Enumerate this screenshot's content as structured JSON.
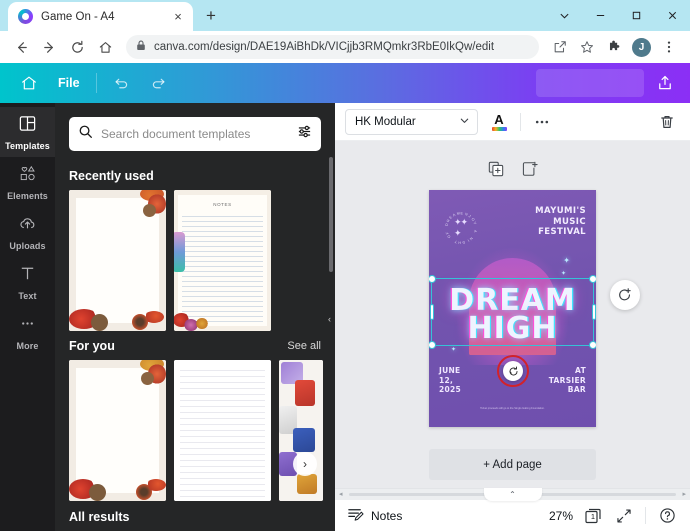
{
  "browser": {
    "tab": {
      "title": "Game On - A4",
      "favicon": "canva-favicon",
      "close": "×"
    },
    "new_tab_label": "+",
    "window_controls": {
      "minimize_chevron": "⌄",
      "minimize": "–",
      "maximize": "□",
      "close": "✕"
    },
    "nav": {
      "back": "←",
      "forward": "→",
      "reload": "⟳",
      "home": "⌂"
    },
    "omnibox": {
      "url": "canva.com/design/DAE19AiBhDk/VICjjb3RMQmkr3RbE0IkQw/edit",
      "lock_icon": "site-lock-icon"
    },
    "toolbar_right": {
      "share_icon": "share-icon",
      "bookmark_icon": "star-icon",
      "extensions_icon": "puzzle-icon",
      "profile_initial": "J",
      "menu_icon": "three-dot-menu-icon"
    }
  },
  "canva_top": {
    "home_icon": "home-icon",
    "file_label": "File",
    "undo_icon": "undo-icon",
    "redo_icon": "redo-icon",
    "share_icon": "upload-share-icon"
  },
  "rail": {
    "items": [
      {
        "label": "Templates",
        "icon": "templates-icon",
        "active": true
      },
      {
        "label": "Elements",
        "icon": "elements-icon",
        "active": false
      },
      {
        "label": "Uploads",
        "icon": "uploads-cloud-icon",
        "active": false
      },
      {
        "label": "Text",
        "icon": "text-t-icon",
        "active": false
      },
      {
        "label": "More",
        "icon": "more-dots-icon",
        "active": false
      }
    ]
  },
  "panel": {
    "search": {
      "placeholder": "Search document templates",
      "search_icon": "search-icon",
      "filter_icon": "filter-sliders-icon"
    },
    "sections": [
      {
        "title": "Recently used",
        "see_all": ""
      },
      {
        "title": "For you",
        "see_all": "See all"
      }
    ],
    "bottom_section": "All results",
    "carousel_next": "›",
    "collapse_arrow": "‹"
  },
  "object_toolbar": {
    "font_name": "HK Modular",
    "dropdown_caret": "⌄",
    "text_color_icon": "text-color-A-icon",
    "more_icon": "more-options-icon",
    "delete_icon": "trash-icon"
  },
  "canvas": {
    "page_tools": {
      "duplicate_icon": "duplicate-page-icon",
      "add_icon": "add-page-icon"
    },
    "rotate_fab": "rotate-handle-icon",
    "annotation": {
      "icon": "refresh-rotate-icon",
      "highlight_color": "#d2222a"
    },
    "add_page_label": "+ Add page"
  },
  "poster": {
    "badge_text": "ENJOY A NIGHT OF DREAM",
    "headline_lines": [
      "MAYUMI'S",
      "MUSIC",
      "FESTIVAL"
    ],
    "title_line1": "DREAM",
    "title_line2": "HIGH",
    "date_lines": [
      "JUNE",
      "12,",
      "2025"
    ],
    "venue_lines": [
      "AT",
      "TARSIER",
      "BAR"
    ],
    "fine_print": "Ticket proceeds will go to the Singlo Galimg Foundation."
  },
  "bottom_bar": {
    "notes_label": "Notes",
    "notes_icon": "notes-icon",
    "zoom_level": "27%",
    "page_number": "1",
    "pages_icon": "pages-icon",
    "fullscreen_icon": "expand-icon",
    "help_icon": "help-question-icon",
    "scroll_left": "◂",
    "scroll_right": "▸",
    "collapse_caret": "⌃"
  }
}
